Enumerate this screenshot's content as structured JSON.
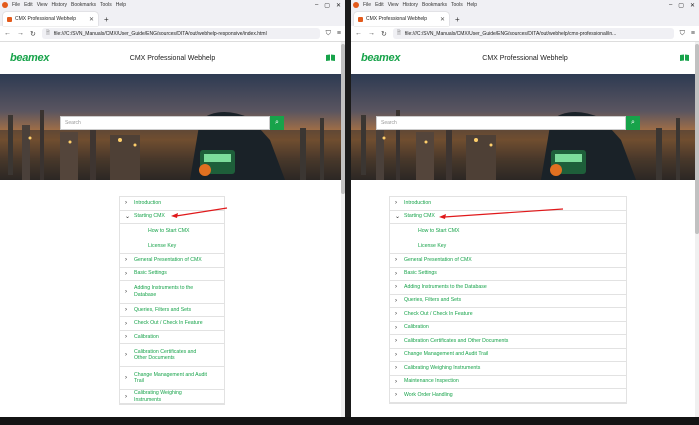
{
  "browser": {
    "menu": [
      "File",
      "Edit",
      "View",
      "History",
      "Bookmarks",
      "Tools",
      "Help"
    ],
    "window_controls": [
      "–",
      "▢",
      "✕"
    ],
    "tab_title": "CMX Professional Webhelp",
    "tab_close": "✕",
    "new_tab": "+",
    "nav": {
      "back": "←",
      "forward": "→",
      "reload": "↻",
      "shield": "⛉",
      "menu": "≡"
    }
  },
  "left": {
    "url": "file:///C:/SVN_Manuals/CMX/User_Guide/ENG/sources/DITA/out/webhelp-responsive/index.html",
    "toc": [
      {
        "label": "Introduction",
        "expanded": false
      },
      {
        "label": "Starting CMX",
        "expanded": true,
        "children": [
          "How to Start CMX",
          "License Key"
        ]
      },
      {
        "label": "General Presentation of CMX",
        "expanded": false
      },
      {
        "label": "Basic Settings",
        "expanded": false
      },
      {
        "label": "Adding Instruments to the Database",
        "expanded": false
      },
      {
        "label": "Queries, Filters and Sets",
        "expanded": false
      },
      {
        "label": "Check Out / Check In Feature",
        "expanded": false
      },
      {
        "label": "Calibration",
        "expanded": false
      },
      {
        "label": "Calibration Certificates and Other Documents",
        "expanded": false
      },
      {
        "label": "Change Management and Audit Trail",
        "expanded": false
      },
      {
        "label": "Calibrating Weighing Instruments",
        "expanded": false
      }
    ]
  },
  "right": {
    "url": "file:///C:/SVN_Manuals/CMX/User_Guide/ENG/sources/DITA/out/webhelp/cmx-professional/in...",
    "toc": [
      {
        "label": "Introduction",
        "expanded": false
      },
      {
        "label": "Starting CMX",
        "expanded": true,
        "children": [
          "How to Start CMX",
          "License Key"
        ]
      },
      {
        "label": "General Presentation of CMX",
        "expanded": false
      },
      {
        "label": "Basic Settings",
        "expanded": false
      },
      {
        "label": "Adding Instruments to the Database",
        "expanded": false
      },
      {
        "label": "Queries, Filters and Sets",
        "expanded": false
      },
      {
        "label": "Check Out / Check In Feature",
        "expanded": false
      },
      {
        "label": "Calibration",
        "expanded": false
      },
      {
        "label": "Calibration Certificates and Other Documents",
        "expanded": false
      },
      {
        "label": "Change Management and Audit Trail",
        "expanded": false
      },
      {
        "label": "Calibrating Weighing Instruments",
        "expanded": false
      },
      {
        "label": "Maintenance Inspection",
        "expanded": false
      },
      {
        "label": "Work Order Handling",
        "expanded": false
      }
    ]
  },
  "page": {
    "brand": "beamex",
    "title": "CMX Professional Webhelp",
    "search_placeholder": "Search",
    "search_icon": "search-icon",
    "header_icon": "book-icon"
  },
  "colors": {
    "accent": "#17a34a",
    "annotation": "#e0191b"
  }
}
